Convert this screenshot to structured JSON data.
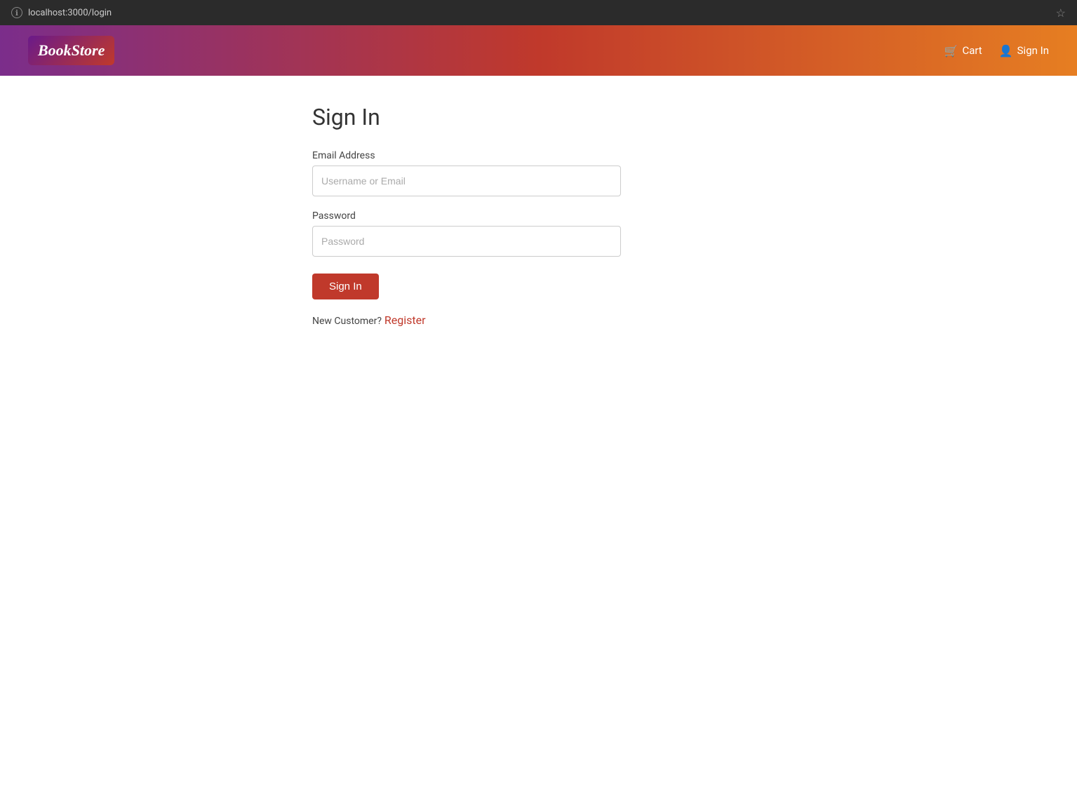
{
  "browser": {
    "url": "localhost:3000/login",
    "info_icon": "ℹ",
    "star_icon": "☆"
  },
  "navbar": {
    "logo_book": "Book",
    "logo_store": "Store",
    "cart_label": "Cart",
    "signin_label": "Sign In"
  },
  "form": {
    "page_title": "Sign In",
    "email_label": "Email Address",
    "email_placeholder": "Username or Email",
    "password_label": "Password",
    "password_placeholder": "Password",
    "signin_button": "Sign In",
    "new_customer_text": "New Customer?",
    "register_label": "Register"
  }
}
